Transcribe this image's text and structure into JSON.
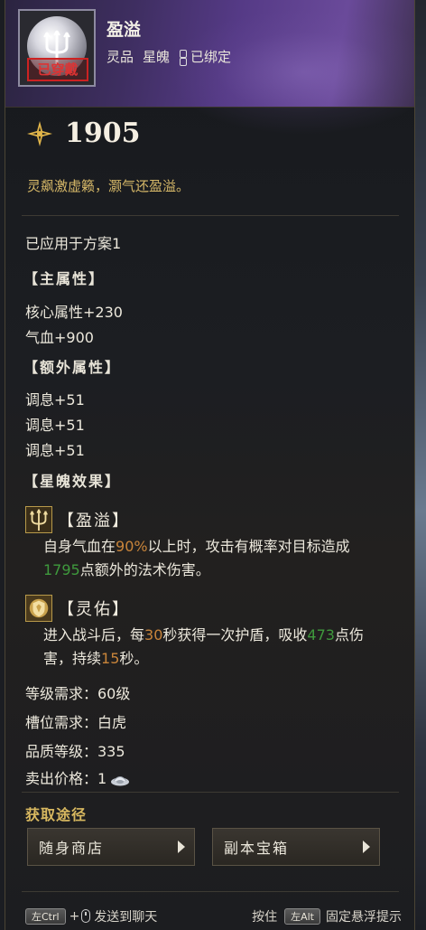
{
  "item": {
    "name": "盈溢",
    "grade": "灵品",
    "type": "星魄",
    "bound": "已绑定",
    "equipped_stamp": "已穿戴",
    "score": "1905",
    "flavor": "灵飙激虚籁，灏气还盈溢。"
  },
  "applied": "已应用于方案1",
  "main_attr": {
    "title": "【主属性】",
    "lines": [
      "核心属性+230",
      "气血+900"
    ]
  },
  "extra_attr": {
    "title": "【额外属性】",
    "lines": [
      "调息+51",
      "调息+51",
      "调息+51"
    ]
  },
  "effects": {
    "title": "【星魄效果】",
    "items": [
      {
        "icon": "trident-icon",
        "name": "【盈溢】",
        "desc": [
          "自身气血在",
          "90%",
          "以上时，攻击有概率对目标造成",
          "1795",
          "点额外的法术伤害。"
        ]
      },
      {
        "icon": "shield-icon",
        "name": "【灵佑】",
        "desc": [
          "进入战斗后，每",
          "30",
          "秒获得一次护盾，吸收",
          "473",
          "点伤害，持续",
          "15",
          "秒。"
        ]
      }
    ]
  },
  "requirements": {
    "level": "等级需求：60级",
    "slot": "槽位需求：白虎",
    "quality": "品质等级：335",
    "price": "卖出价格：1"
  },
  "acquire": {
    "title": "获取途径",
    "buttons": [
      "随身商店",
      "副本宝箱"
    ]
  },
  "footer": {
    "ctrl_key": "左Ctrl",
    "plus": "+",
    "send": "发送到聊天",
    "hold": "按住",
    "alt_key": "左Alt",
    "pin": "固定悬浮提示"
  },
  "colors": {
    "highlight_orange": "#c8843a",
    "highlight_green": "#3f9a3d",
    "flavor_gold": "#d6b868",
    "header_purple": "#553a86"
  }
}
